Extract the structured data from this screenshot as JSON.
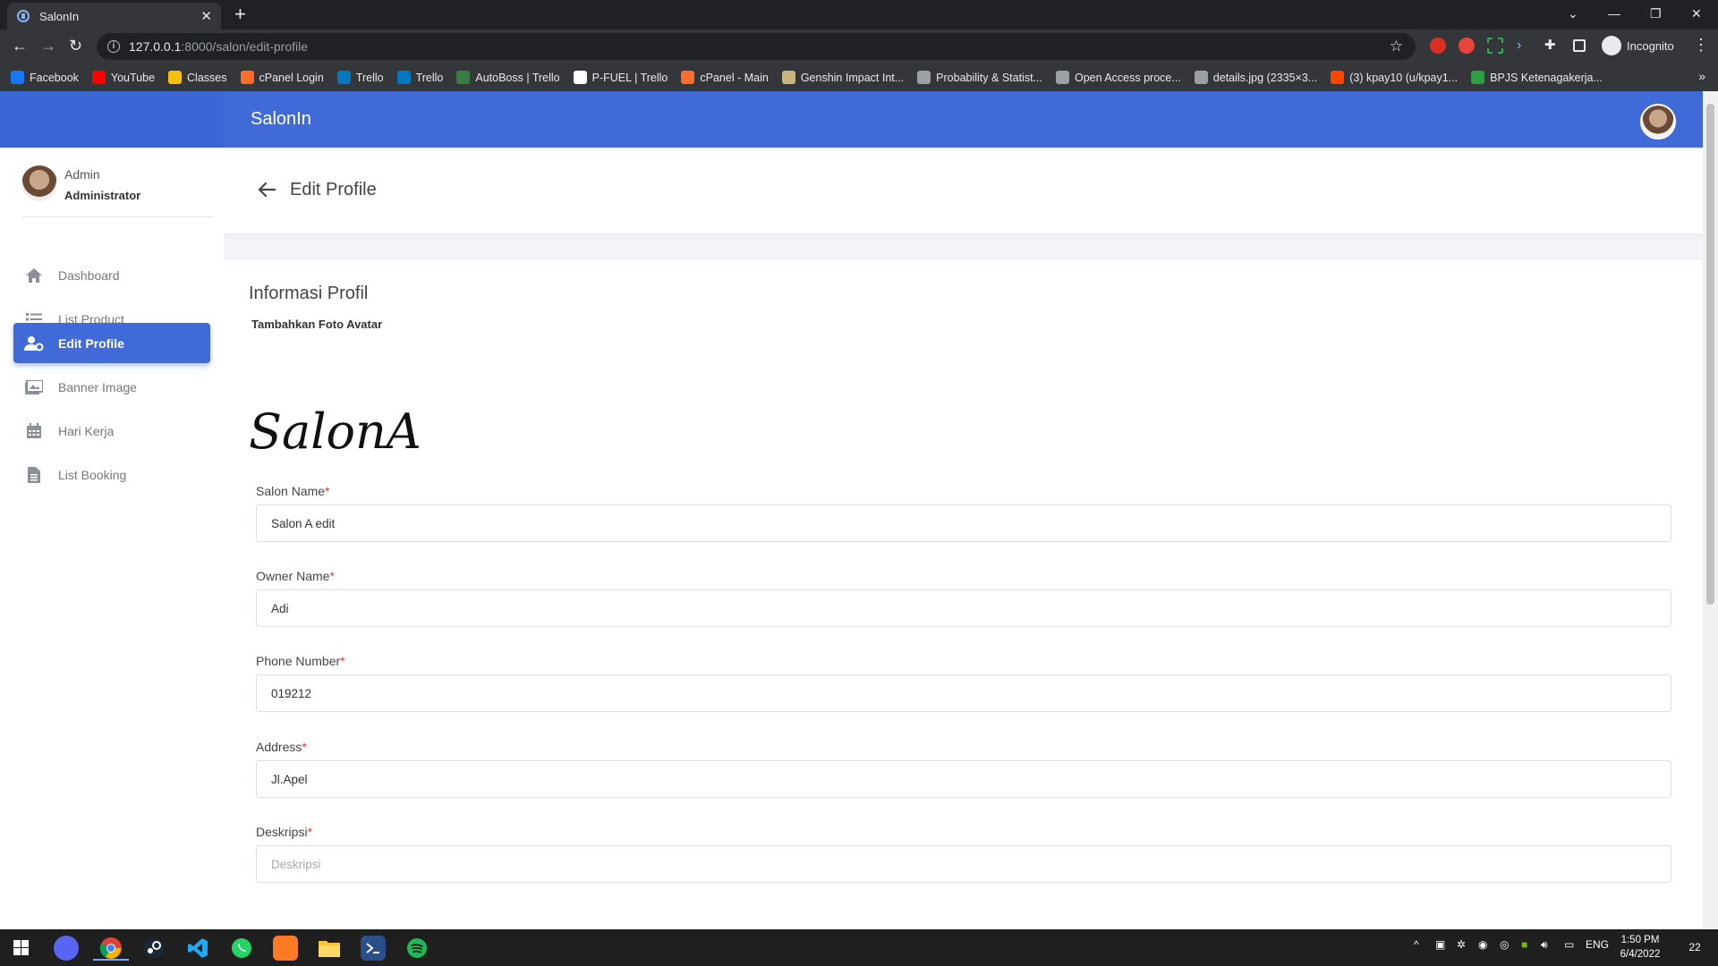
{
  "browser": {
    "tab_title": "SalonIn",
    "url_host": "127.0.0.1",
    "url_path": ":8000/salon/edit-profile",
    "profile_label": "Incognito",
    "bookmarks": [
      {
        "label": "Facebook",
        "color": "#1877f2"
      },
      {
        "label": "YouTube",
        "color": "#ff0000"
      },
      {
        "label": "Classes",
        "color": "#f4c20d"
      },
      {
        "label": "cPanel Login",
        "color": "#ff6c2c"
      },
      {
        "label": "Trello",
        "color": "#0079bf"
      },
      {
        "label": "Trello",
        "color": "#0079bf"
      },
      {
        "label": "AutoBoss | Trello",
        "color": "#3a7d44"
      },
      {
        "label": "P-FUEL | Trello",
        "color": "#ffffff"
      },
      {
        "label": "cPanel - Main",
        "color": "#ff6c2c"
      },
      {
        "label": "Genshin Impact Int...",
        "color": "#c9b37e"
      },
      {
        "label": "Probability & Statist...",
        "color": "#9aa0a6"
      },
      {
        "label": "Open Access proce...",
        "color": "#9aa0a6"
      },
      {
        "label": "details.jpg (2335×3...",
        "color": "#9aa0a6"
      },
      {
        "label": "(3) kpay10 (u/kpay1...",
        "color": "#ff4500"
      },
      {
        "label": "BPJS Ketenagakerja...",
        "color": "#2e9e44"
      }
    ]
  },
  "app": {
    "brand": "SalonIn",
    "accent": "#3f6ad8",
    "user": {
      "name": "Admin",
      "role": "Administrator"
    },
    "menu": [
      {
        "label": "Dashboard",
        "icon": "home-icon"
      },
      {
        "label": "List Product",
        "icon": "list-icon"
      },
      {
        "label": "Edit Profile",
        "icon": "user-cog-icon",
        "active": true
      },
      {
        "label": "Banner Image",
        "icon": "images-icon"
      },
      {
        "label": "Hari Kerja",
        "icon": "calendar-icon"
      },
      {
        "label": "List Booking",
        "icon": "file-icon"
      }
    ]
  },
  "page": {
    "title": "Edit Profile",
    "section_title": "Informasi Profil",
    "avatar_label": "Tambahkan Foto Avatar",
    "logo_text": "SalonA",
    "fields": {
      "salon_name": {
        "label": "Salon Name",
        "value": "Salon A edit"
      },
      "owner_name": {
        "label": "Owner Name",
        "value": "Adi"
      },
      "phone": {
        "label": "Phone Number",
        "value": "019212"
      },
      "address": {
        "label": "Address",
        "value": "Jl.Apel"
      },
      "description": {
        "label": "Deskripsi",
        "placeholder": "Deskripsi"
      }
    },
    "required_mark": "*"
  },
  "taskbar": {
    "language": "ENG",
    "time": "1:50 PM",
    "date": "6/4/2022",
    "notifications": "22"
  }
}
